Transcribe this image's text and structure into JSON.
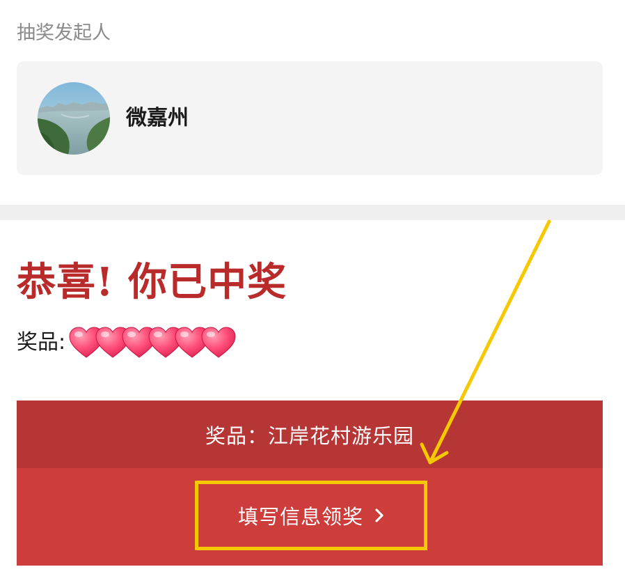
{
  "initiator": {
    "label": "抽奖发起人",
    "name": "微嘉州",
    "avatar_icon": "landscape-river-avatar"
  },
  "result": {
    "title": "恭喜! 你已中奖",
    "prize_label": "奖品:",
    "prize_hearts_icon": "heart-icon",
    "prize_hearts_count": 6
  },
  "prize_banner": {
    "text": "奖品：江岸花村游乐园"
  },
  "claim": {
    "label": "填写信息领奖",
    "icon": "chevron-right-icon"
  },
  "annotation": {
    "highlight_color": "#f6c800",
    "arrow_color": "#f6c800"
  },
  "colors": {
    "title_red": "#b92a2a",
    "banner_red": "#b63535",
    "claim_red": "#cc3d3b",
    "card_gray": "#f4f4f4",
    "divider_gray": "#efefef"
  }
}
